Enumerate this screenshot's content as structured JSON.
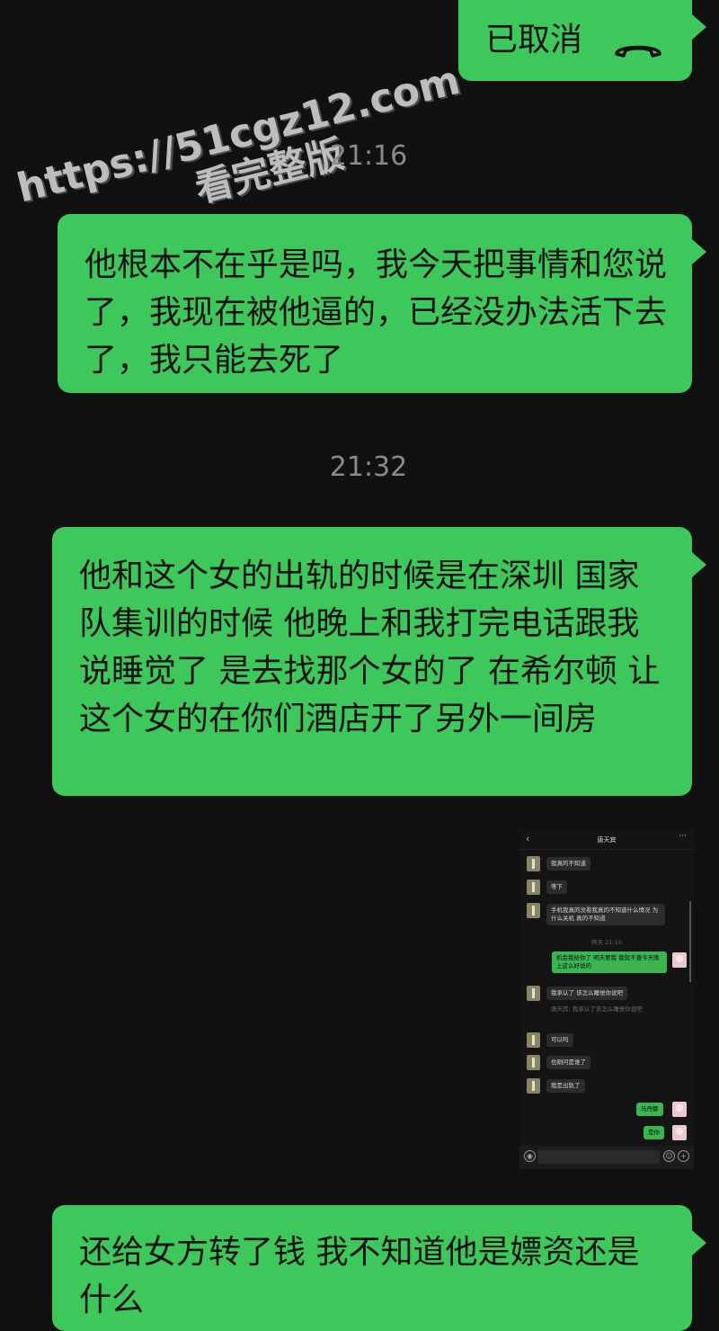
{
  "watermark": {
    "line1": "https://51cgz12.com",
    "line2": "看完整版"
  },
  "call_bubble": {
    "text": "已取消",
    "icon": "hangup-phone-icon"
  },
  "timestamps": [
    "21:16",
    "21:32"
  ],
  "messages": [
    "他根本不在乎是吗，我今天把事情和您说了，我现在被他逼的，已经没办法活下去了，我只能去死了",
    "他和这个女的出轨的时候是在深圳 国家队集训的时候 他晚上和我打完电话跟我说睡觉了 是去找那个女的了 在希尔顿 让这个女的在你们酒店开了另外一间房",
    "还给女方转了钱 我不知道他是嫖资还是什么"
  ],
  "embedded_screenshot": {
    "title": "唐天宾",
    "messages": [
      {
        "side": "left",
        "text": "我真的不知道"
      },
      {
        "side": "left",
        "text": "等下"
      },
      {
        "side": "left",
        "text": "手机我真的没看我真的不知道什么情况 为什么关机 真的不知道"
      },
      {
        "side": "system",
        "text": "昨天 21:10"
      },
      {
        "side": "right",
        "text": "机会我给你了 明天要我 我就不查今天晚上这么好说的"
      },
      {
        "side": "left",
        "text": "我承认了 该怎么睡觉你说吧"
      },
      {
        "side": "system",
        "text": "唐天宾: 我承认了该怎么睡觉你说吧"
      },
      {
        "side": "left",
        "text": "可以吗"
      },
      {
        "side": "left",
        "text": "也刚问是谁了"
      },
      {
        "side": "left",
        "text": "我是出轨了"
      },
      {
        "side": "right",
        "text": "马丹娜"
      },
      {
        "side": "right",
        "text": "是你"
      }
    ]
  }
}
